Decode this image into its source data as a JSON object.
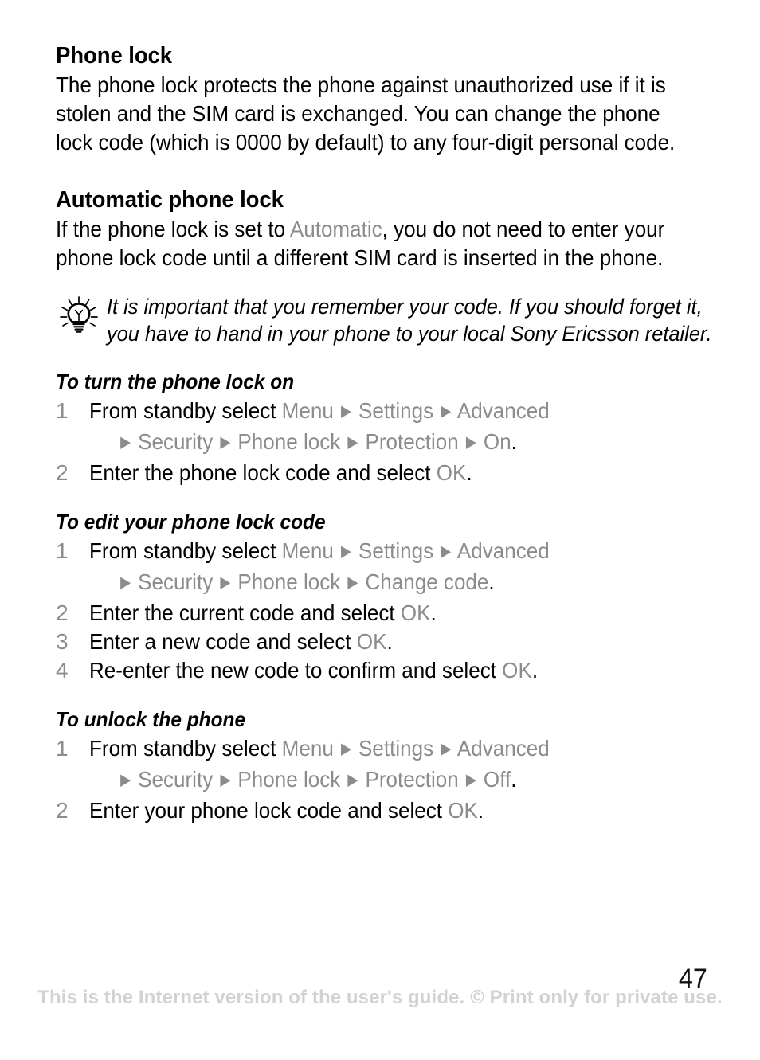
{
  "page": {
    "number": "47",
    "watermark": "This is the Internet version of the user's guide. © Print only for private use."
  },
  "colors": {
    "text": "#000000",
    "menu_gray": "#8c8c8c",
    "step_number_gray": "#8c8c8c",
    "watermark_gray": "#d2d2d2"
  },
  "sections": {
    "phone_lock": {
      "heading": "Phone lock",
      "body": "The phone lock protects the phone against unauthorized use if it is stolen and the SIM card is exchanged. You can change the phone lock code (which is 0000 by default) to any four-digit personal code."
    },
    "automatic_phone_lock": {
      "heading": "Automatic phone lock",
      "body_part1": "If the phone lock is set to ",
      "body_highlight": "Automatic",
      "body_part2": ", you do not need to enter your phone lock code until a different SIM card is inserted in the phone."
    }
  },
  "tip": {
    "icon": "lightbulb-icon",
    "text": "It is important that you remember your code. If you should forget it, you have to hand in your phone to your local Sony Ericsson retailer."
  },
  "arrow_glyph": "▶",
  "procedures": [
    {
      "title": "To turn the phone lock on",
      "steps": [
        {
          "number": "1",
          "lead": "From standby select ",
          "path_line1": [
            "Menu",
            "Settings",
            "Advanced"
          ],
          "path_line2": [
            "Security",
            "Phone lock",
            "Protection",
            "On"
          ],
          "terminator": "."
        },
        {
          "number": "2",
          "lead": "Enter the phone lock code and select ",
          "path_inline": [
            "OK"
          ],
          "terminator": "."
        }
      ]
    },
    {
      "title": "To edit your phone lock code",
      "steps": [
        {
          "number": "1",
          "lead": "From standby select ",
          "path_line1": [
            "Menu",
            "Settings",
            "Advanced"
          ],
          "path_line2": [
            "Security",
            "Phone lock",
            "Change code"
          ],
          "terminator": "."
        },
        {
          "number": "2",
          "lead": "Enter the current code and select ",
          "path_inline": [
            "OK"
          ],
          "terminator": "."
        },
        {
          "number": "3",
          "lead": "Enter a new code and select ",
          "path_inline": [
            "OK"
          ],
          "terminator": "."
        },
        {
          "number": "4",
          "lead": "Re-enter the new code to confirm and select ",
          "path_inline": [
            "OK"
          ],
          "terminator": "."
        }
      ]
    },
    {
      "title": "To unlock the phone",
      "steps": [
        {
          "number": "1",
          "lead": "From standby select ",
          "path_line1": [
            "Menu",
            "Settings",
            "Advanced"
          ],
          "path_line2": [
            "Security",
            "Phone lock",
            "Protection",
            "Off"
          ],
          "terminator": "."
        },
        {
          "number": "2",
          "lead": "Enter your phone lock code and select ",
          "path_inline": [
            "OK"
          ],
          "terminator": "."
        }
      ]
    }
  ]
}
